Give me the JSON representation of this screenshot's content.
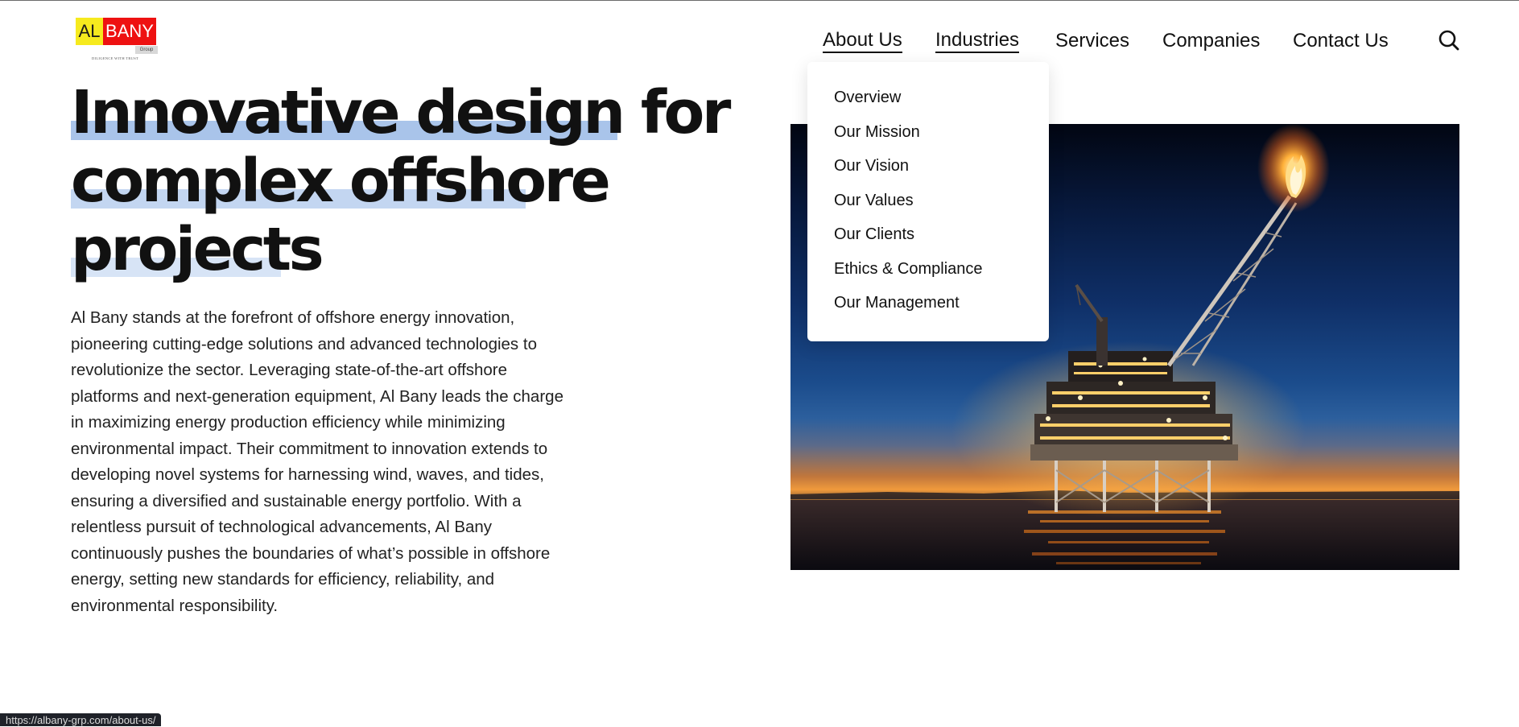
{
  "logo": {
    "left_text": "AL",
    "right_text": "BANY",
    "group_text": "Group",
    "tagline": "DILIGENCE WITH TRUST"
  },
  "nav": {
    "items": [
      {
        "label": "About Us",
        "underlined": true
      },
      {
        "label": "Industries",
        "underlined": true
      },
      {
        "label": "Services",
        "underlined": false
      },
      {
        "label": "Companies",
        "underlined": false
      },
      {
        "label": "Contact Us",
        "underlined": false
      }
    ],
    "search_icon": "search-icon"
  },
  "dropdown": {
    "items": [
      "Overview",
      "Our Mission",
      "Our Vision",
      "Our Values",
      "Our Clients",
      "Ethics & Compliance",
      "Our Management"
    ]
  },
  "hero": {
    "headline_lines": [
      "Innovative design for",
      "complex offshore",
      "projects"
    ],
    "highlight_colors": [
      "#a9c4ea",
      "#c3d6f1",
      "#d7e4f6"
    ],
    "body_lines": [
      "Al Bany stands at the forefront of offshore energy innovation,",
      "pioneering cutting-edge solutions and advanced technologies to",
      "revolutionize the sector. Leveraging state-of-the-art offshore",
      "platforms and next-generation equipment, Al Bany leads the charge",
      "in maximizing energy production efficiency while minimizing",
      "environmental impact. Their commitment to innovation extends to",
      "developing novel systems for harnessing wind, waves, and tides,",
      "ensuring a diversified and sustainable energy portfolio. With a",
      "relentless pursuit of technological advancements, Al Bany",
      "continuously pushes the boundaries of what’s possible in offshore",
      "energy, setting new standards for efficiency, reliability, and",
      "environmental responsibility."
    ]
  },
  "photo": {
    "subject": "offshore-oil-platform-at-dusk"
  },
  "status_bar": {
    "url": "https://albany-grp.com/about-us/"
  }
}
